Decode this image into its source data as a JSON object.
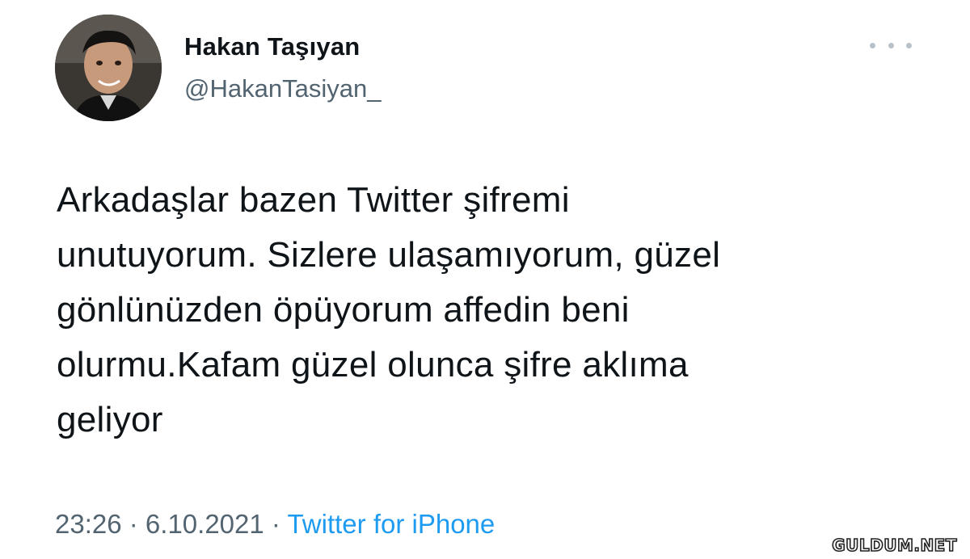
{
  "author": {
    "display_name": "Hakan Taşıyan",
    "handle": "@HakanTasiyan_"
  },
  "more_icon": "ellipsis-icon",
  "tweet": {
    "lines": [
      "Arkadaşlar bazen Twitter şifremi",
      "unutuyorum. Sizlere ulaşamıyorum, güzel",
      "gönlünüzden öpüyorum affedin beni",
      "olurmu.Kafam güzel olunca şifre aklıma",
      "geliyor"
    ]
  },
  "meta": {
    "time": "23:26",
    "separator": " · ",
    "date": "6.10.2021",
    "source": "Twitter for iPhone"
  },
  "watermark": {
    "text": "GULDUM.NET"
  },
  "colors": {
    "text_primary": "#0f1419",
    "text_secondary": "#536471",
    "link": "#1d9bf0",
    "background": "#ffffff"
  }
}
